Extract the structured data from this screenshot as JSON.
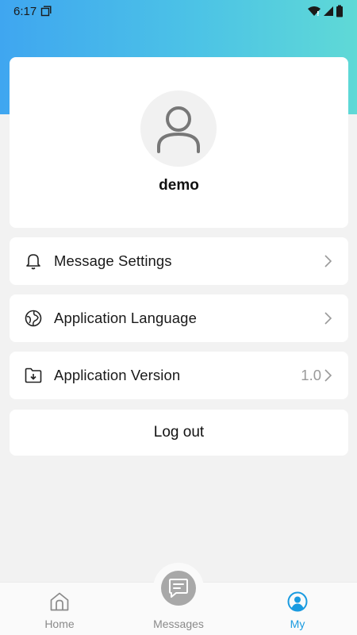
{
  "status_bar": {
    "time": "6:17",
    "icons": [
      "screenshot-icon",
      "wifi-icon",
      "signal-icon",
      "battery-icon"
    ]
  },
  "profile": {
    "username": "demo",
    "avatar_icon": "user-icon"
  },
  "menu": {
    "items": [
      {
        "label": "Message Settings",
        "icon": "bell-icon",
        "value": ""
      },
      {
        "label": "Application Language",
        "icon": "globe-icon",
        "value": ""
      },
      {
        "label": "Application Version",
        "icon": "folder-download-icon",
        "value": "1.0"
      }
    ]
  },
  "logout": {
    "label": "Log out"
  },
  "tabbar": {
    "tabs": [
      {
        "label": "Home",
        "icon": "home-icon"
      },
      {
        "label": "Messages",
        "icon": "chat-icon"
      },
      {
        "label": "My",
        "icon": "profile-icon"
      }
    ],
    "active": "My"
  },
  "colors": {
    "header_gradient_start": "#3fa6f0",
    "header_gradient_end": "#5fd9d6",
    "accent": "#1a9be0",
    "background": "#f2f2f2"
  }
}
